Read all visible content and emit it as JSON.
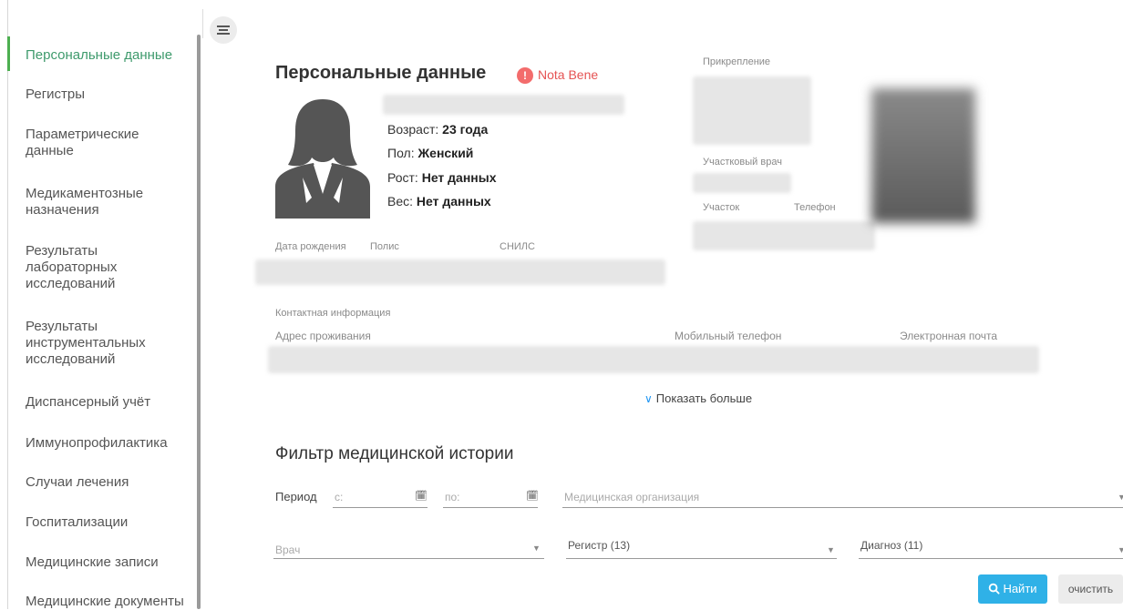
{
  "sidebar": {
    "items": [
      {
        "label": "Персональные данные",
        "lines": [
          "Персональные данные"
        ],
        "active": true
      },
      {
        "lines": [
          "Регистры"
        ]
      },
      {
        "lines": [
          "Параметрические",
          "данные"
        ]
      },
      {
        "lines": [
          "Медикаментозные",
          "назначения"
        ]
      },
      {
        "lines": [
          "Результаты",
          "лабораторных",
          "исследований"
        ]
      },
      {
        "lines": [
          "Результаты",
          "инструментальных",
          "исследований"
        ]
      },
      {
        "lines": [
          "Диспансерный учёт"
        ]
      },
      {
        "lines": [
          "Иммунопрофилактика"
        ]
      },
      {
        "lines": [
          "Случаи лечения"
        ]
      },
      {
        "lines": [
          "Госпитализации"
        ]
      },
      {
        "lines": [
          "Медицинские записи"
        ]
      },
      {
        "lines": [
          "Медицинские документы"
        ]
      }
    ]
  },
  "header": {
    "menu_icon": "hamburger-icon"
  },
  "patient": {
    "title": "Персональные данные",
    "nota_bene_mark": "!",
    "nota_bene": "Nota Bene",
    "age_label": "Возраст:",
    "age_value": "23 года",
    "sex_label": "Пол:",
    "sex_value": "Женский",
    "height_label": "Рост:",
    "height_value": "Нет данных",
    "weight_label": "Вес:",
    "weight_value": "Нет данных",
    "dob_label": "Дата рождения",
    "policy_label": "Полис",
    "snils_label": "СНИЛС",
    "attachment_label": "Прикрепление",
    "doctor_label": "Участковый врач",
    "area_label": "Участок",
    "phone_label": "Телефон"
  },
  "contacts": {
    "section_label": "Контактная информация",
    "address_label": "Адрес проживания",
    "mobile_label": "Мобильный телефон",
    "email_label": "Электронная почта",
    "show_more": "Показать больше"
  },
  "filter": {
    "title": "Фильтр медицинской истории",
    "period_label": "Период",
    "from_placeholder": "с:",
    "to_placeholder": "по:",
    "org_placeholder": "Медицинская организация",
    "doctor_placeholder": "Врач",
    "registry_value": "Регистр (13)",
    "diagnosis_value": "Диагноз (11)",
    "find_button": "Найти",
    "clear_button": "очистить"
  },
  "colors": {
    "accent_green": "#4caf50",
    "nota_bene_red": "#e55353",
    "find_blue": "#2fb1e7"
  }
}
